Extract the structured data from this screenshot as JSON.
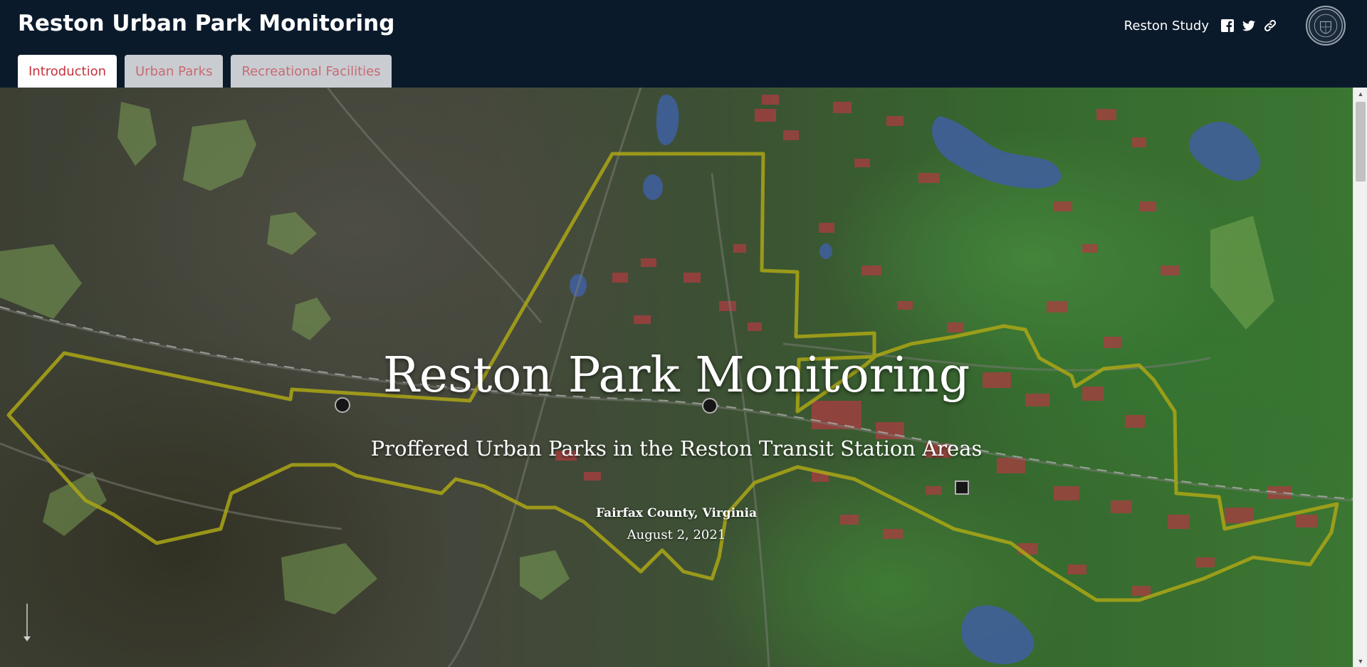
{
  "header": {
    "title": "Reston Urban Park Monitoring",
    "tabs": [
      {
        "label": "Introduction",
        "active": true
      },
      {
        "label": "Urban Parks",
        "active": false
      },
      {
        "label": "Recreational Facilities",
        "active": false
      }
    ],
    "study_link": "Reston Study",
    "share_icons": [
      "facebook-icon",
      "twitter-icon",
      "link-icon"
    ],
    "seal": "county-seal-logo"
  },
  "hero": {
    "title": "Reston Park Monitoring",
    "subtitle": "Proffered Urban Parks in the Reston Transit Station Areas",
    "place": "Fairfax County, Virginia",
    "date": "August 2, 2021",
    "scroll_icon": "down-arrow-icon"
  },
  "colors": {
    "header_bg": "#0b1a2b",
    "tab_active_text": "#c8323c",
    "tab_inactive_text": "#c86a72",
    "tab_inactive_bg": "#c9ccd1",
    "boundary": "#c8c21a",
    "water": "#4a6fb5",
    "buildings": "#c8474b"
  }
}
